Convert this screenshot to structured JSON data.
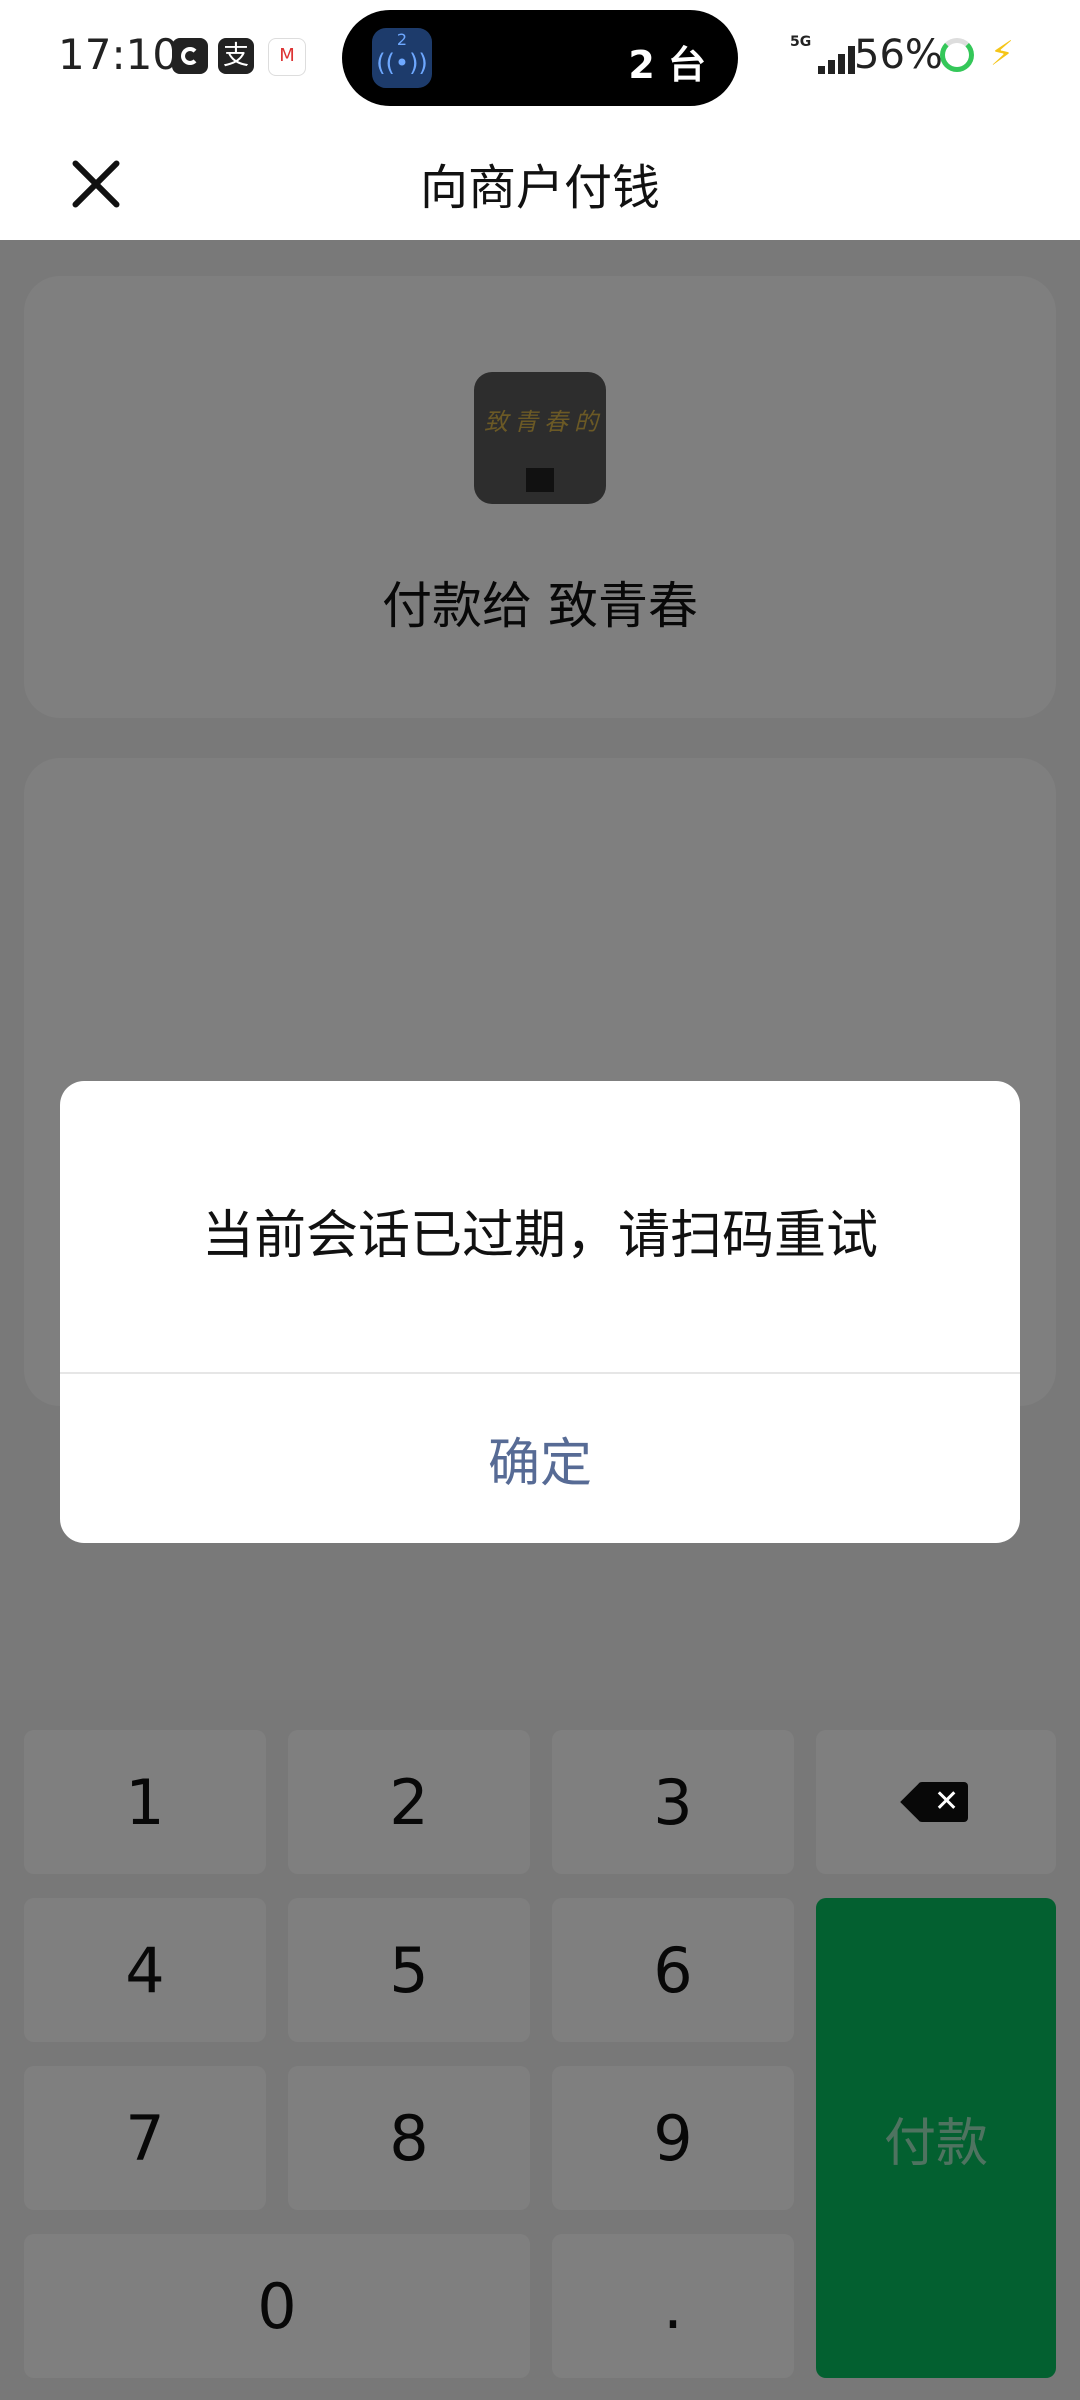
{
  "status_bar": {
    "time": "17:10",
    "pill_badge_number": "2",
    "pill_text": "2 台",
    "network": "5G",
    "battery_percent": "56%"
  },
  "header": {
    "title": "向商户付钱"
  },
  "merchant": {
    "avatar_sign": "致青春的味道",
    "pay_to": "付款给 致青春"
  },
  "keypad": {
    "keys": [
      "1",
      "2",
      "3",
      "4",
      "5",
      "6",
      "7",
      "8",
      "9",
      "0",
      "."
    ],
    "pay_label": "付款"
  },
  "dialog": {
    "message": "当前会话已过期，请扫码重试",
    "confirm_label": "确定"
  },
  "colors": {
    "pay_green": "#07c160",
    "link_blue": "#576b95",
    "overlay": "rgba(0,0,0,0.5)"
  }
}
